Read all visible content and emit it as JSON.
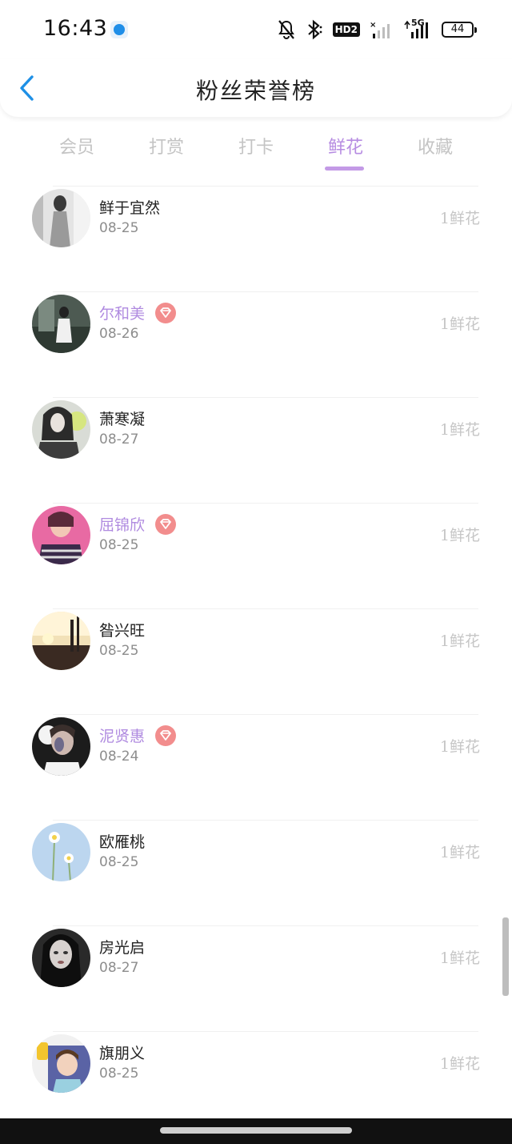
{
  "status_bar": {
    "time": "16:43",
    "network": "5G",
    "hd": "HD2",
    "battery": "44"
  },
  "header": {
    "title": "粉丝荣誉榜"
  },
  "tabs": [
    {
      "label": "会员",
      "active": false
    },
    {
      "label": "打赏",
      "active": false
    },
    {
      "label": "打卡",
      "active": false
    },
    {
      "label": "鲜花",
      "active": true
    },
    {
      "label": "收藏",
      "active": false
    }
  ],
  "fans": [
    {
      "name": "鲜于宜然",
      "date": "08-25",
      "amount": "1鲜花",
      "vip": false
    },
    {
      "name": "尔和美",
      "date": "08-26",
      "amount": "1鲜花",
      "vip": true
    },
    {
      "name": "萧寒凝",
      "date": "08-27",
      "amount": "1鲜花",
      "vip": false
    },
    {
      "name": "屈锦欣",
      "date": "08-25",
      "amount": "1鲜花",
      "vip": true
    },
    {
      "name": "昝兴旺",
      "date": "08-25",
      "amount": "1鲜花",
      "vip": false
    },
    {
      "name": "泥贤惠",
      "date": "08-24",
      "amount": "1鲜花",
      "vip": true
    },
    {
      "name": "欧雁桃",
      "date": "08-25",
      "amount": "1鲜花",
      "vip": false
    },
    {
      "name": "房光启",
      "date": "08-27",
      "amount": "1鲜花",
      "vip": false
    },
    {
      "name": "旗朋义",
      "date": "08-25",
      "amount": "1鲜花",
      "vip": false
    }
  ],
  "colors": {
    "accent": "#b78de2",
    "vip_name": "#b08be0",
    "vip_badge": "#f28d8d",
    "back_arrow": "#1e90e6"
  }
}
